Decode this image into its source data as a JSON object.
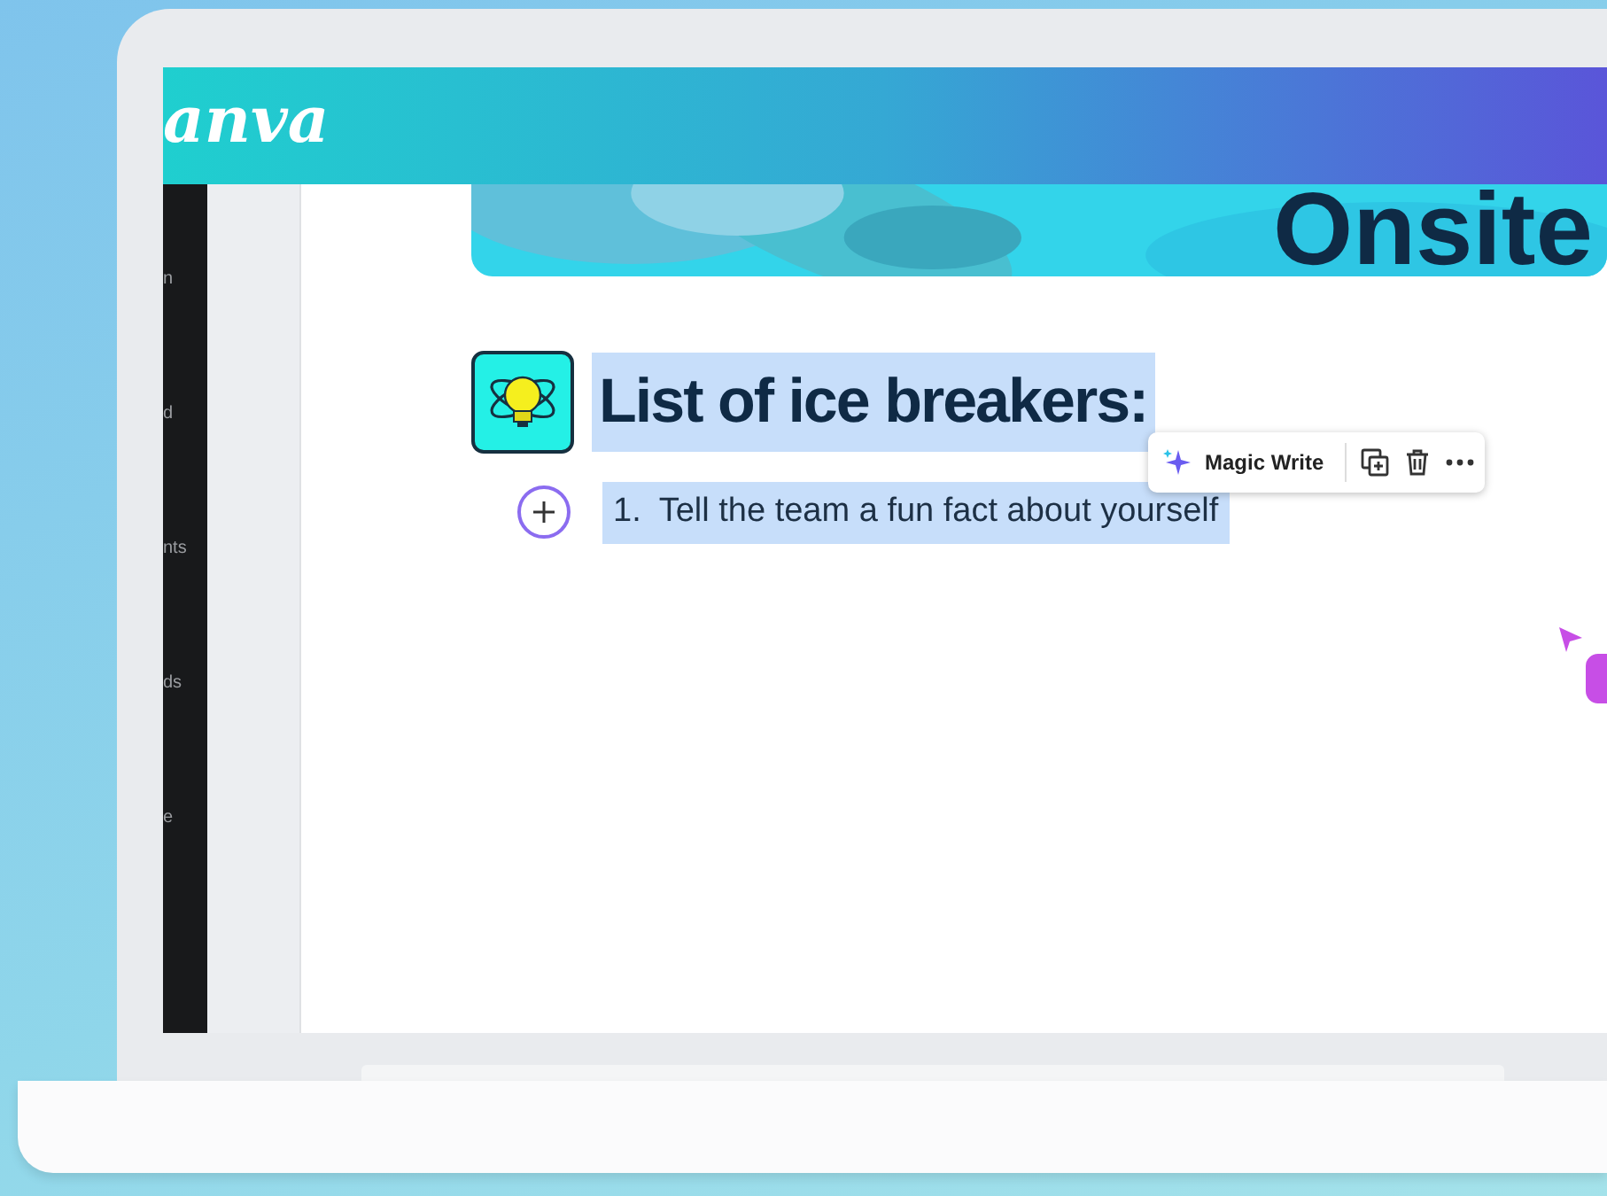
{
  "header": {
    "logo": "anva"
  },
  "sidebar": {
    "items": [
      {
        "label": "n"
      },
      {
        "label": "d"
      },
      {
        "label": "nts"
      },
      {
        "label": "ds"
      },
      {
        "label": "e"
      }
    ]
  },
  "banner": {
    "title": "Onsite"
  },
  "document": {
    "heading": {
      "text": "List of ice breakers:",
      "highlighted": true
    },
    "list": [
      {
        "number": "1.",
        "text": "Tell the team a fun fact about yourself",
        "highlighted": true
      }
    ]
  },
  "toolbar": {
    "magic_write": "Magic Write"
  }
}
